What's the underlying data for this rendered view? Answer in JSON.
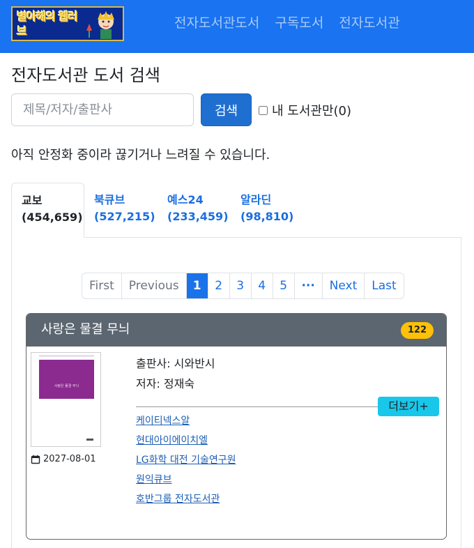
{
  "navbar": {
    "logo_text": "별아해의 웹러브",
    "links": [
      "전자도서관도서",
      "구독도서",
      "전자도서관"
    ]
  },
  "page_title": "전자도서관 도서 검색",
  "search": {
    "placeholder": "제목/저자/출판사",
    "button_label": "검색",
    "my_library_label": "내 도서관만(0)"
  },
  "notice": "아직 안정화 중이라 끊기거나 느려질 수 있습니다.",
  "tabs": [
    {
      "name": "교보",
      "count": "(454,659)",
      "active": true
    },
    {
      "name": "북큐브",
      "count": "(527,215)",
      "active": false
    },
    {
      "name": "예스24",
      "count": "(233,459)",
      "active": false
    },
    {
      "name": "알라딘",
      "count": "(98,810)",
      "active": false
    }
  ],
  "pagination": {
    "first": "First",
    "previous": "Previous",
    "pages": [
      "1",
      "2",
      "3",
      "4",
      "5"
    ],
    "current": "1",
    "ellipsis": "···",
    "next": "Next",
    "last": "Last"
  },
  "book": {
    "title": "사랑은 물결 무늬",
    "badge": "122",
    "cover_title": "사랑은 물결 무늬",
    "publisher_line": "출판사: 시와반시",
    "author_line": "저자: 정재숙",
    "date": "2027-08-01",
    "more_label": "더보기+",
    "libraries": [
      "케이티넥스알",
      "현대아이에이치엘",
      "LG화학 대전 기술연구원",
      "원익큐브",
      "호반그룹 전자도서관"
    ]
  },
  "colors": {
    "navbar": "#1a73f0",
    "primary_button": "#1f6fd1",
    "badge": "#ffc107",
    "more_button": "#18c7ea",
    "card_header": "#5c6670"
  },
  "icons": {
    "date": "calendar-icon"
  }
}
